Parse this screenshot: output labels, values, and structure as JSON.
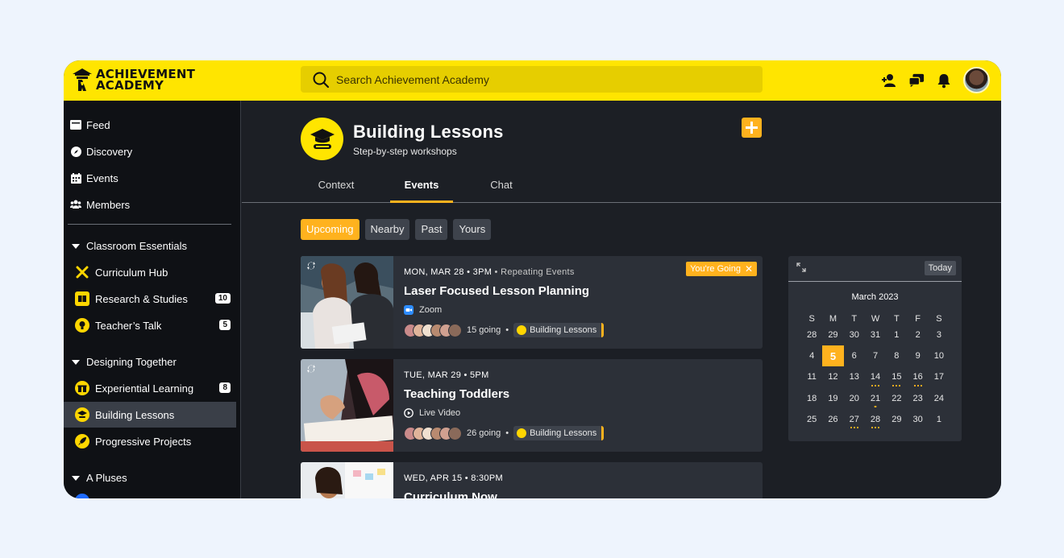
{
  "brand": {
    "line1": "ACHIEVEMENT",
    "line2": "ACADEMY"
  },
  "search": {
    "placeholder": "Search Achievement Academy"
  },
  "sidebar": {
    "nav": [
      {
        "label": "Feed"
      },
      {
        "label": "Discovery"
      },
      {
        "label": "Events"
      },
      {
        "label": "Members"
      }
    ],
    "sections": [
      {
        "title": "Classroom Essentials",
        "spaces": [
          {
            "label": "Curriculum Hub",
            "badge": ""
          },
          {
            "label": "Research & Studies",
            "badge": "10"
          },
          {
            "label": "Teacher’s Talk",
            "badge": "5"
          }
        ]
      },
      {
        "title": "Designing Together",
        "spaces": [
          {
            "label": "Experiential Learning",
            "badge": "8"
          },
          {
            "label": "Building Lessons",
            "badge": ""
          },
          {
            "label": "Progressive Projects",
            "badge": ""
          }
        ]
      },
      {
        "title": "A Pluses",
        "spaces": []
      }
    ]
  },
  "group": {
    "title": "Building Lessons",
    "subtitle": "Step-by-step workshops"
  },
  "tabs": [
    {
      "label": "Context"
    },
    {
      "label": "Events"
    },
    {
      "label": "Chat"
    }
  ],
  "filters": [
    {
      "label": "Upcoming"
    },
    {
      "label": "Nearby"
    },
    {
      "label": "Past"
    },
    {
      "label": "Yours"
    }
  ],
  "events": [
    {
      "when": "MON, MAR 28 • 3PM",
      "when_sub": "Repeating Events",
      "title": "Laser Focused Lesson Planning",
      "location": "Zoom",
      "going": "15 going",
      "space": "Building Lessons",
      "status": "You're Going"
    },
    {
      "when": "TUE, MAR 29 • 5PM",
      "when_sub": "",
      "title": "Teaching Toddlers",
      "location": "Live Video",
      "going": "26 going",
      "space": "Building Lessons",
      "status": ""
    },
    {
      "when": "WED, APR 15  •  8:30PM",
      "when_sub": "",
      "title": "Curriculum Now",
      "location": "",
      "going": "",
      "space": "",
      "status": ""
    }
  ],
  "calendar": {
    "today_label": "Today",
    "month": "March 2023",
    "weekdays": [
      "S",
      "M",
      "T",
      "W",
      "T",
      "F",
      "S"
    ],
    "weeks": [
      [
        "28",
        "29",
        "30",
        "31",
        "1",
        "2",
        "3"
      ],
      [
        "4",
        "5",
        "6",
        "7",
        "8",
        "9",
        "10"
      ],
      [
        "11",
        "12",
        "13",
        "14",
        "15",
        "16",
        "17"
      ],
      [
        "18",
        "19",
        "20",
        "21",
        "22",
        "23",
        "24"
      ],
      [
        "25",
        "26",
        "27",
        "28",
        "29",
        "30",
        "1"
      ]
    ],
    "selected": "5"
  },
  "colors": {
    "brand_yellow": "#ffe500",
    "accent_orange": "#ffb21e",
    "bg_dark": "#1c1f25",
    "card": "#2c3038"
  }
}
